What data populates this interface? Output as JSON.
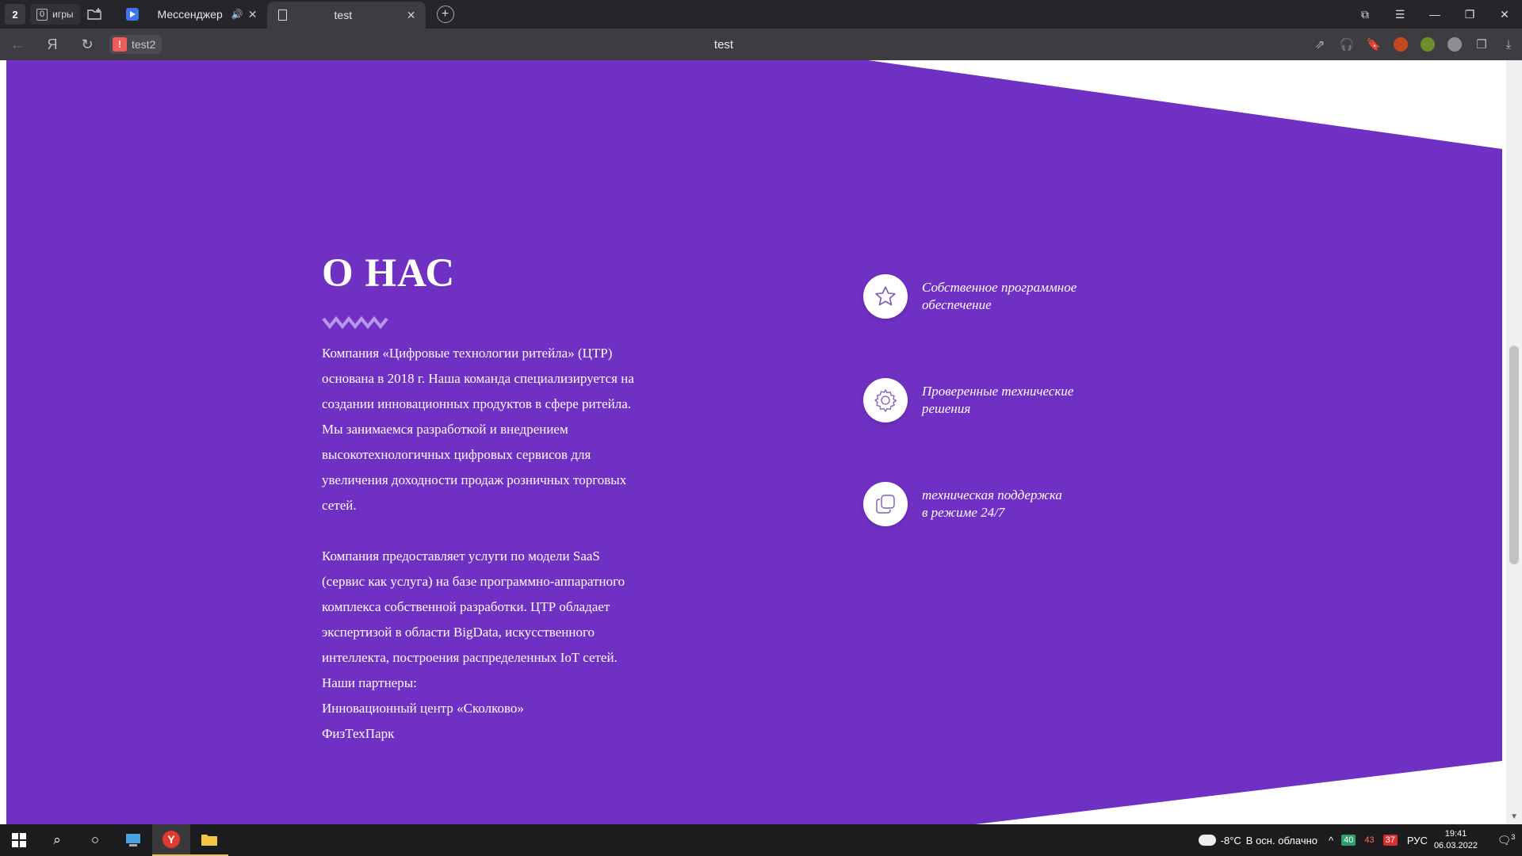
{
  "browser": {
    "tab_group_count": "2",
    "games": {
      "count": "0",
      "label": "игры"
    },
    "tabs": [
      {
        "title": "Мессенджер",
        "sound": "🔊",
        "close": "✕"
      },
      {
        "title": "test",
        "close": "✕"
      }
    ],
    "new_tab": "+",
    "window_controls": {
      "tabs_menu": "⧉",
      "menu": "☰",
      "minimize": "—",
      "restore": "❐",
      "close": "✕"
    },
    "address": {
      "site_name": "test2",
      "page_title": "test",
      "warning_glyph": "!"
    },
    "nav": {
      "back": "←",
      "yandex": "Я",
      "reload": "↻"
    },
    "tools": {
      "share": "⇗",
      "headphones": "🎧",
      "bookmark": "🔖",
      "collections": "❐",
      "downloads": "⤓"
    }
  },
  "page": {
    "colors": {
      "purple": "#7030c4",
      "white": "#ffffff"
    },
    "about": {
      "title": "О НАС",
      "paragraph1": "Компания «Цифровые технологии ритейла» (ЦТР) основана в 2018 г. Наша команда специализируется на создании инновационных продуктов в сфере ритейла. Мы занимаемся разработкой и внедрением высокотехнологичных цифровых сервисов для увеличения доходности продаж розничных торговых сетей.",
      "paragraph2": "Компания предоставляет услуги по модели SaaS (сервис как услуга) на базе программно-аппаратного комплекса собственной разработки. ЦТР обладает экспертизой в области BigData, искусственного интеллекта, построения распределенных IoT сетей.",
      "partners_label": "Наши партнеры:",
      "partner1": "Инновационный центр «Сколково»",
      "partner2": "ФизТехПарк"
    },
    "features": [
      {
        "icon": "star-icon",
        "line1": "Собственное программное",
        "line2": "обеспечение"
      },
      {
        "icon": "gear-icon",
        "line1": "Проверенные технические",
        "line2": "решения"
      },
      {
        "icon": "copy-icon",
        "line1": "техническая поддержка",
        "line2": "в режиме 24/7"
      }
    ]
  },
  "taskbar": {
    "start": "⊞",
    "search": "⌕",
    "cortana": "○",
    "weather": {
      "temp": "-8°C",
      "desc": "В осн. облачно"
    },
    "tray_chevron": "^",
    "badges": [
      {
        "value": "40",
        "color": "#2e9e6a"
      },
      {
        "value": "43",
        "color": "#c0392b"
      },
      {
        "value": "37",
        "color": "#d83030"
      }
    ],
    "language": "РУС",
    "time": "19:41",
    "date": "06.03.2022",
    "notifications": "3"
  }
}
